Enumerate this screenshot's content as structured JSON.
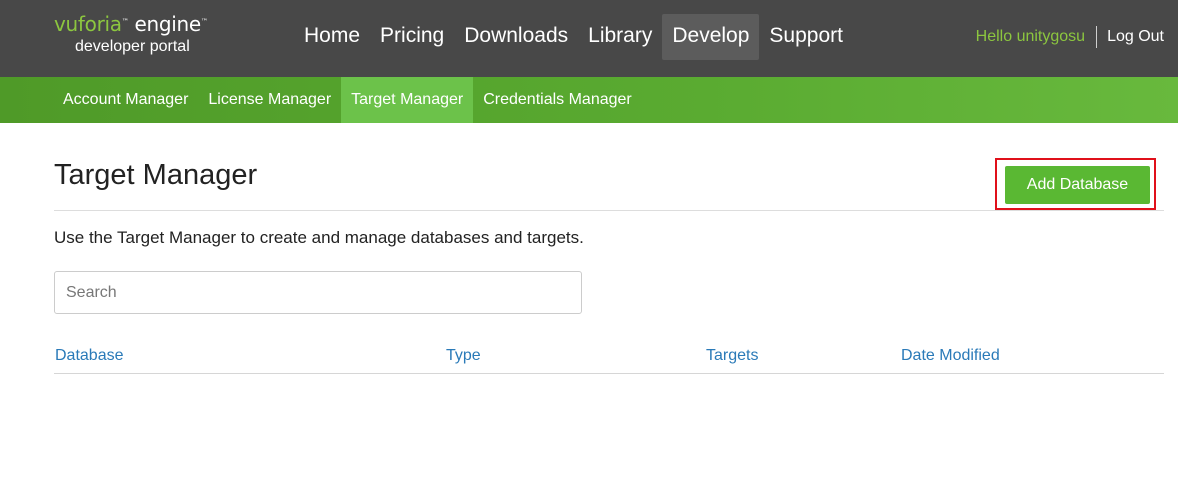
{
  "header": {
    "logo": {
      "brand": "vuforia",
      "product": "engine",
      "tagline": "developer portal"
    },
    "nav": [
      {
        "label": "Home"
      },
      {
        "label": "Pricing"
      },
      {
        "label": "Downloads"
      },
      {
        "label": "Library"
      },
      {
        "label": "Develop",
        "active": true
      },
      {
        "label": "Support"
      }
    ],
    "user": {
      "greeting": "Hello unitygosu",
      "logout_label": "Log Out"
    }
  },
  "subnav": {
    "items": [
      {
        "label": "Account Manager"
      },
      {
        "label": "License Manager"
      },
      {
        "label": "Target Manager",
        "active": true
      },
      {
        "label": "Credentials Manager"
      }
    ]
  },
  "main": {
    "title": "Target Manager",
    "add_button_label": "Add Database",
    "intro": "Use the Target Manager to create and manage databases and targets.",
    "search": {
      "placeholder": "Search",
      "value": ""
    },
    "table": {
      "columns": [
        "Database",
        "Type",
        "Targets",
        "Date Modified"
      ],
      "rows": []
    }
  },
  "colors": {
    "header_bg": "#484848",
    "brand_green": "#8cc63f",
    "subnav_green": "#5aab31",
    "button_green": "#5ab833",
    "link_blue": "#2a7ab8",
    "highlight_red": "#e0101a"
  }
}
